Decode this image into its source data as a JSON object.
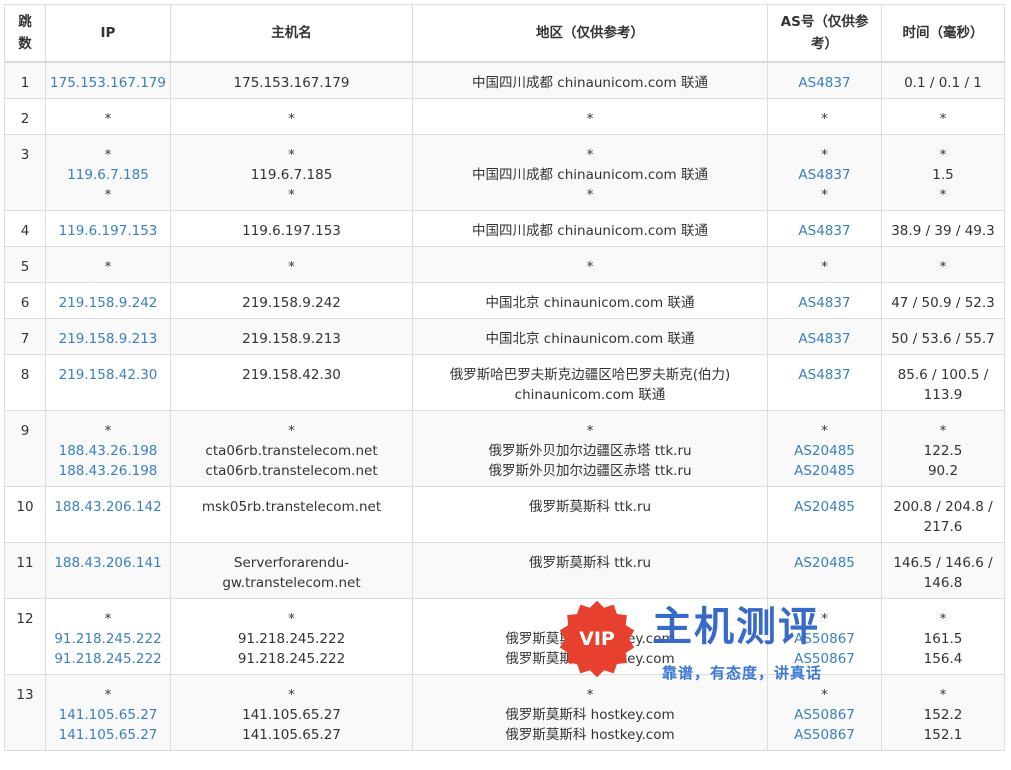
{
  "headers": {
    "hop": "跳数",
    "ip": "IP",
    "host": "主机名",
    "region": "地区（仅供参考）",
    "as": "AS号（仅供参考）",
    "time": "时间（毫秒）"
  },
  "rows": [
    {
      "hop": "1",
      "ip": [
        "175.153.167.179"
      ],
      "host": [
        "175.153.167.179"
      ],
      "region": [
        "中国四川成都 chinaunicom.com 联通"
      ],
      "as": [
        "AS4837"
      ],
      "time": [
        "0.1 / 0.1 / 1"
      ]
    },
    {
      "hop": "2",
      "ip": [
        "*"
      ],
      "host": [
        "*"
      ],
      "region": [
        "*"
      ],
      "as": [
        "*"
      ],
      "time": [
        "*"
      ]
    },
    {
      "hop": "3",
      "ip": [
        "*",
        "119.6.7.185",
        "*"
      ],
      "host": [
        "*",
        "119.6.7.185",
        "*"
      ],
      "region": [
        "*",
        "中国四川成都 chinaunicom.com 联通",
        "*"
      ],
      "as": [
        "*",
        "AS4837",
        "*"
      ],
      "time": [
        "*",
        "1.5",
        "*"
      ]
    },
    {
      "hop": "4",
      "ip": [
        "119.6.197.153"
      ],
      "host": [
        "119.6.197.153"
      ],
      "region": [
        "中国四川成都 chinaunicom.com 联通"
      ],
      "as": [
        "AS4837"
      ],
      "time": [
        "38.9 / 39 / 49.3"
      ]
    },
    {
      "hop": "5",
      "ip": [
        "*"
      ],
      "host": [
        "*"
      ],
      "region": [
        "*"
      ],
      "as": [
        "*"
      ],
      "time": [
        "*"
      ]
    },
    {
      "hop": "6",
      "ip": [
        "219.158.9.242"
      ],
      "host": [
        "219.158.9.242"
      ],
      "region": [
        "中国北京 chinaunicom.com 联通"
      ],
      "as": [
        "AS4837"
      ],
      "time": [
        "47 / 50.9 / 52.3"
      ]
    },
    {
      "hop": "7",
      "ip": [
        "219.158.9.213"
      ],
      "host": [
        "219.158.9.213"
      ],
      "region": [
        "中国北京 chinaunicom.com 联通"
      ],
      "as": [
        "AS4837"
      ],
      "time": [
        "50 / 53.6 / 55.7"
      ]
    },
    {
      "hop": "8",
      "ip": [
        "219.158.42.30"
      ],
      "host": [
        "219.158.42.30"
      ],
      "region": [
        "俄罗斯哈巴罗夫斯克边疆区哈巴罗夫斯克(伯力)",
        "chinaunicom.com 联通"
      ],
      "as": [
        "AS4837"
      ],
      "time": [
        "85.6 / 100.5 /",
        "113.9"
      ]
    },
    {
      "hop": "9",
      "ip": [
        "*",
        "188.43.26.198",
        "188.43.26.198"
      ],
      "host": [
        "*",
        "cta06rb.transtelecom.net",
        "cta06rb.transtelecom.net"
      ],
      "region": [
        "*",
        "俄罗斯外贝加尔边疆区赤塔 ttk.ru",
        "俄罗斯外贝加尔边疆区赤塔 ttk.ru"
      ],
      "as": [
        "*",
        "AS20485",
        "AS20485"
      ],
      "time": [
        "*",
        "122.5",
        "90.2"
      ]
    },
    {
      "hop": "10",
      "ip": [
        "188.43.206.142"
      ],
      "host": [
        "msk05rb.transtelecom.net"
      ],
      "region": [
        "俄罗斯莫斯科 ttk.ru"
      ],
      "as": [
        "AS20485"
      ],
      "time": [
        "200.8 / 204.8 /",
        "217.6"
      ]
    },
    {
      "hop": "11",
      "ip": [
        "188.43.206.141"
      ],
      "host": [
        "Serverforarendu-",
        "gw.transtelecom.net"
      ],
      "region": [
        "俄罗斯莫斯科 ttk.ru"
      ],
      "as": [
        "AS20485"
      ],
      "time": [
        "146.5 / 146.6 /",
        "146.8"
      ]
    },
    {
      "hop": "12",
      "ip": [
        "*",
        "91.218.245.222",
        "91.218.245.222"
      ],
      "host": [
        "*",
        "91.218.245.222",
        "91.218.245.222"
      ],
      "region": [
        "*",
        "俄罗斯莫斯科 hostkey.com",
        "俄罗斯莫斯科 hostkey.com"
      ],
      "as": [
        "*",
        "AS50867",
        "AS50867"
      ],
      "time": [
        "*",
        "161.5",
        "156.4"
      ]
    },
    {
      "hop": "13",
      "ip": [
        "*",
        "141.105.65.27",
        "141.105.65.27"
      ],
      "host": [
        "*",
        "141.105.65.27",
        "141.105.65.27"
      ],
      "region": [
        "*",
        "俄罗斯莫斯科 hostkey.com",
        "俄罗斯莫斯科 hostkey.com"
      ],
      "as": [
        "*",
        "AS50867",
        "AS50867"
      ],
      "time": [
        "*",
        "152.2",
        "152.1"
      ]
    }
  ],
  "link_color": "#3a7fc1",
  "watermark": {
    "badge": "VIP",
    "title": "主机测评",
    "subtitle": "靠谱，有态度，讲真话",
    "badge_color": "#e8402e",
    "title_color": "#2e63c8"
  }
}
